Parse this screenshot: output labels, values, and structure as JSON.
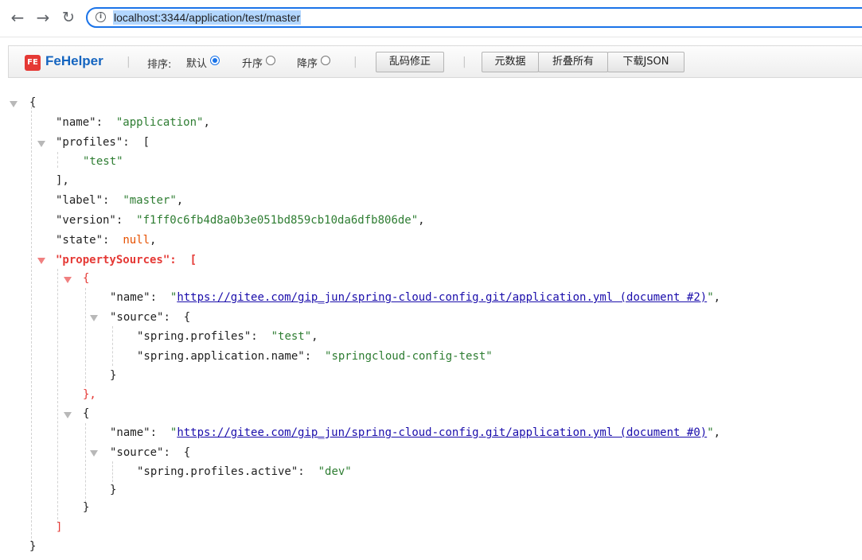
{
  "browser": {
    "url": "localhost:3344/application/test/master",
    "back_icon": "←",
    "forward_icon": "→",
    "reload_icon": "↻",
    "info_icon": "i"
  },
  "toolbar": {
    "logo_text": "FE",
    "title": "FeHelper",
    "separator": "|",
    "sort_label": "排序:",
    "sort_options": [
      {
        "label": "默认",
        "checked": true
      },
      {
        "label": "升序",
        "checked": false
      },
      {
        "label": "降序",
        "checked": false
      }
    ],
    "fix_encoding_button": "乱码修正",
    "metadata_button": "元数据",
    "collapse_all_button": "折叠所有",
    "download_json_button": "下载JSON"
  },
  "json": {
    "open_brace": "{",
    "close_brace": "}",
    "name_key": "\"name\"",
    "name_value": "\"application\"",
    "profiles_key": "\"profiles\"",
    "profiles_open": "[",
    "profiles_item": "\"test\"",
    "profiles_close": "],",
    "label_key": "\"label\"",
    "label_value": "\"master\"",
    "version_key": "\"version\"",
    "version_value": "\"f1ff0c6fb4d8a0b3e051bd859cb10da6dfb806de\"",
    "state_key": "\"state\"",
    "state_value": "null",
    "property_sources_key": "\"propertySources\"",
    "property_sources_open": "[",
    "property_sources_close": "]",
    "sources": [
      {
        "open": "{",
        "name_key": "\"name\"",
        "name_value": "https://gitee.com/gip_jun/spring-cloud-config.git/application.yml (document #2)",
        "source_key": "\"source\"",
        "source_open": "{",
        "entries": [
          {
            "key": "\"spring.profiles\"",
            "value": "\"test\""
          },
          {
            "key": "\"spring.application.name\"",
            "value": "\"springcloud-config-test\""
          }
        ],
        "source_close": "}",
        "close": "},"
      },
      {
        "open": "{",
        "name_key": "\"name\"",
        "name_value": "https://gitee.com/gip_jun/spring-cloud-config.git/application.yml (document #0)",
        "source_key": "\"source\"",
        "source_open": "{",
        "entries": [
          {
            "key": "\"spring.profiles.active\"",
            "value": "\"dev\""
          }
        ],
        "source_close": "}",
        "close": "}"
      }
    ]
  },
  "colors": {
    "string": "#2e7d32",
    "null": "#e65100",
    "link": "#1a0dab",
    "highlight": "#e53935",
    "accent": "#1a73e8"
  }
}
